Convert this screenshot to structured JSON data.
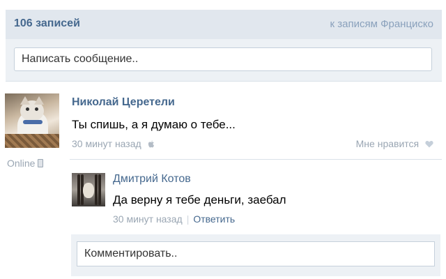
{
  "header": {
    "count_label": "106 записей",
    "back_link": "к записям Франциско"
  },
  "composer": {
    "placeholder": "Написать сообщение.."
  },
  "post": {
    "author": "Николай Церетели",
    "status": "Online",
    "text": "Ты спишь, а я думаю о тебе...",
    "time": "30 минут назад",
    "device_icon": "apple-icon",
    "like_label": "Мне нравится"
  },
  "comment": {
    "author": "Дмитрий Котов",
    "text": "Да верну я тебе деньги, заебал",
    "time": "30 минут назад",
    "separator": "|",
    "reply_label": "Ответить"
  },
  "comment_composer": {
    "placeholder": "Комментировать.."
  },
  "colors": {
    "link_blue": "#45688e",
    "muted_gray": "#9aa6b3",
    "header_bg": "#e1e7ee",
    "input_area_bg": "#edf1f5"
  }
}
